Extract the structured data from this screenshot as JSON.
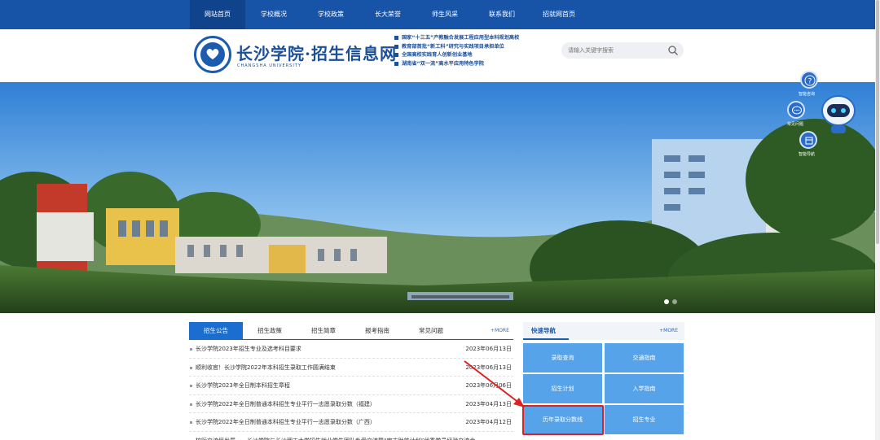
{
  "nav": {
    "items": [
      {
        "label": "网站首页",
        "active": true
      },
      {
        "label": "学校概况"
      },
      {
        "label": "学校政策"
      },
      {
        "label": "长大荣誉"
      },
      {
        "label": "师生风采"
      },
      {
        "label": "联系我们"
      },
      {
        "label": "招就网首页"
      }
    ]
  },
  "header": {
    "site_title": "长沙学院·招生信息网",
    "site_subtitle": "CHANGSHA UNIVERSITY",
    "slogans": [
      "国家“十三五”产教融合发展工程应用型本科规划高校",
      "教育部首批“新工科”研究与实践项目承担单位",
      "全国高校实践育人创新创业基地",
      "湖南省“双一流”高水平应用特色学院"
    ],
    "search_placeholder": "请输入关键字搜索"
  },
  "floating_tools": {
    "labels": [
      "智能咨询",
      "常见问题",
      "智能导航"
    ]
  },
  "notices": {
    "tabs": [
      {
        "label": "招生公告",
        "active": true
      },
      {
        "label": "招生政策"
      },
      {
        "label": "招生简章"
      },
      {
        "label": "报考指南"
      },
      {
        "label": "常见问题"
      }
    ],
    "more": "+MORE",
    "items": [
      {
        "title": "长沙学院2023年招生专业及选考科目要求",
        "date": "2023年06月13日"
      },
      {
        "title": "顺利收官！长沙学院2022年本科招生录取工作圆满结束",
        "date": "2023年06月13日"
      },
      {
        "title": "长沙学院2023年全日制本科招生章程",
        "date": "2023年06月06日"
      },
      {
        "title": "长沙学院2022年全日制普通本科招生专业平行一志愿录取分数（福建）",
        "date": "2023年04月13日"
      },
      {
        "title": "长沙学院2022年全日制普通本科招生专业平行一志愿录取分数（广西）",
        "date": "2023年04月12日"
      },
      {
        "title": "校际交流促发展——长沙学院与长沙理工大学招生就业学生团队赴爱交流暨“宏志助航计划”优秀学员经验交流会",
        "date": ""
      }
    ]
  },
  "quick_nav": {
    "title": "快速导航",
    "more": "+MORE",
    "buttons": [
      "录取查询",
      "交通指南",
      "招生计划",
      "入学指南",
      "历年录取分数线",
      "招生专业"
    ]
  },
  "colors": {
    "nav_bg": "#1753a6",
    "accent": "#1b6dd0",
    "quick_nav_btn": "#56a3ea",
    "highlight": "#e02020"
  }
}
